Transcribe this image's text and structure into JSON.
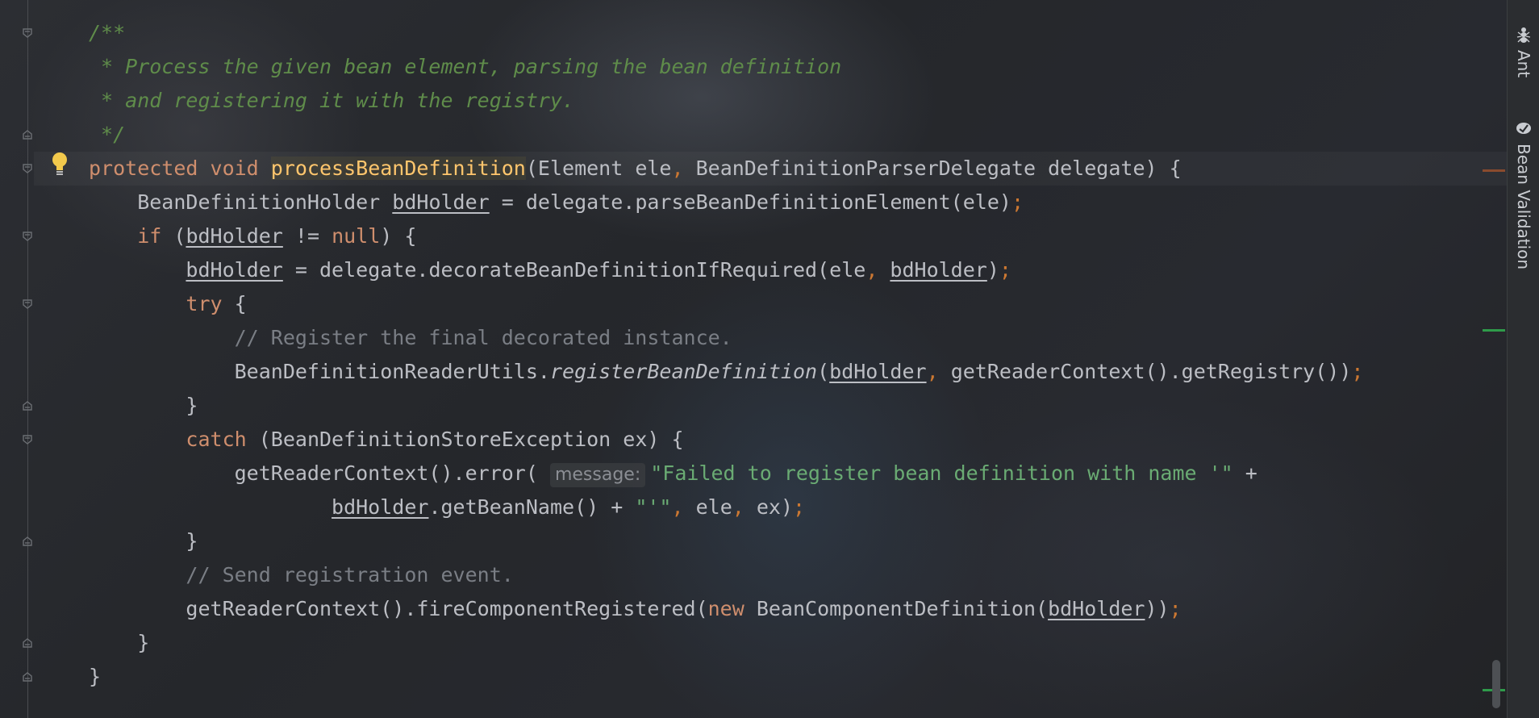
{
  "editor": {
    "lines": [
      {
        "segments": [
          {
            "t": "/**",
            "c": "comment-doc"
          }
        ]
      },
      {
        "segments": [
          {
            "t": " * Process the given bean element, parsing the bean definition",
            "c": "comment-doc"
          }
        ]
      },
      {
        "segments": [
          {
            "t": " * and registering it with the registry.",
            "c": "comment-doc"
          }
        ]
      },
      {
        "segments": [
          {
            "t": " */",
            "c": "comment-doc"
          }
        ]
      },
      {
        "segments": [
          {
            "t": "protected ",
            "c": "kw"
          },
          {
            "t": "void ",
            "c": "kw"
          },
          {
            "t": "processBeanDefinition",
            "c": "fn"
          },
          {
            "t": "(Element ele",
            "c": ""
          },
          {
            "t": ", ",
            "c": "punct"
          },
          {
            "t": "BeanDefinitionParserDelegate delegate) {",
            "c": ""
          }
        ]
      },
      {
        "segments": [
          {
            "t": "    BeanDefinitionHolder ",
            "c": ""
          },
          {
            "t": "bdHolder",
            "c": "var"
          },
          {
            "t": " = delegate.parseBeanDefinitionElement(ele)",
            "c": ""
          },
          {
            "t": ";",
            "c": "punct"
          }
        ]
      },
      {
        "segments": [
          {
            "t": "    ",
            "c": ""
          },
          {
            "t": "if",
            "c": "kw"
          },
          {
            "t": " (",
            "c": ""
          },
          {
            "t": "bdHolder",
            "c": "var"
          },
          {
            "t": " != ",
            "c": ""
          },
          {
            "t": "null",
            "c": "kw"
          },
          {
            "t": ") {",
            "c": ""
          }
        ]
      },
      {
        "segments": [
          {
            "t": "        ",
            "c": ""
          },
          {
            "t": "bdHolder",
            "c": "var"
          },
          {
            "t": " = delegate.decorateBeanDefinitionIfRequired(ele",
            "c": ""
          },
          {
            "t": ", ",
            "c": "punct"
          },
          {
            "t": "bdHolder",
            "c": "var"
          },
          {
            "t": ")",
            "c": ""
          },
          {
            "t": ";",
            "c": "punct"
          }
        ]
      },
      {
        "segments": [
          {
            "t": "        ",
            "c": ""
          },
          {
            "t": "try",
            "c": "kw"
          },
          {
            "t": " {",
            "c": ""
          }
        ]
      },
      {
        "segments": [
          {
            "t": "            // Register the final decorated instance.",
            "c": "comment"
          }
        ]
      },
      {
        "segments": [
          {
            "t": "            BeanDefinitionReaderUtils.",
            "c": ""
          },
          {
            "t": "registerBeanDefinition",
            "c": "ital"
          },
          {
            "t": "(",
            "c": ""
          },
          {
            "t": "bdHolder",
            "c": "var"
          },
          {
            "t": ", ",
            "c": "punct"
          },
          {
            "t": "getReaderContext().getRegistry())",
            "c": ""
          },
          {
            "t": ";",
            "c": "punct"
          }
        ]
      },
      {
        "segments": [
          {
            "t": "        }",
            "c": ""
          }
        ]
      },
      {
        "segments": [
          {
            "t": "        ",
            "c": ""
          },
          {
            "t": "catch",
            "c": "kw"
          },
          {
            "t": " (BeanDefinitionStoreException ex) {",
            "c": ""
          }
        ]
      },
      {
        "segments": [
          {
            "t": "            getReaderContext().error( ",
            "c": ""
          },
          {
            "t": "message:",
            "c": "hint"
          },
          {
            "t": "\"Failed to register bean definition with name '\"",
            "c": "str"
          },
          {
            "t": " +",
            "c": ""
          }
        ]
      },
      {
        "segments": [
          {
            "t": "                    ",
            "c": ""
          },
          {
            "t": "bdHolder",
            "c": "var"
          },
          {
            "t": ".getBeanName() + ",
            "c": ""
          },
          {
            "t": "\"'\"",
            "c": "str"
          },
          {
            "t": ", ",
            "c": "punct"
          },
          {
            "t": "ele",
            "c": ""
          },
          {
            "t": ", ",
            "c": "punct"
          },
          {
            "t": "ex)",
            "c": ""
          },
          {
            "t": ";",
            "c": "punct"
          }
        ]
      },
      {
        "segments": [
          {
            "t": "        }",
            "c": ""
          }
        ]
      },
      {
        "segments": [
          {
            "t": "        // Send registration event.",
            "c": "comment"
          }
        ]
      },
      {
        "segments": [
          {
            "t": "        getReaderContext().fireComponentRegistered(",
            "c": ""
          },
          {
            "t": "new",
            "c": "kw"
          },
          {
            "t": " BeanComponentDefinition(",
            "c": ""
          },
          {
            "t": "bdHolder",
            "c": "var"
          },
          {
            "t": "))",
            "c": ""
          },
          {
            "t": ";",
            "c": "punct"
          }
        ]
      },
      {
        "segments": [
          {
            "t": "    }",
            "c": ""
          }
        ]
      },
      {
        "segments": [
          {
            "t": "}",
            "c": ""
          }
        ]
      }
    ]
  },
  "right_panel": {
    "ant_label": "Ant",
    "ant_icon": "ant-icon",
    "bean_validation_label": "Bean Validation",
    "bean_validation_icon": "bean-validation-icon"
  },
  "gutter": {
    "bulb_icon": "intention-bulb-icon",
    "fold_icon": "fold-marker-icon"
  },
  "colors": {
    "keyword": "#cf8e6d",
    "doc_comment": "#5f8c4a",
    "line_comment": "#7a7e85",
    "function_name": "#ffc66d",
    "string": "#6aab73",
    "default_text": "#bcbec4"
  }
}
